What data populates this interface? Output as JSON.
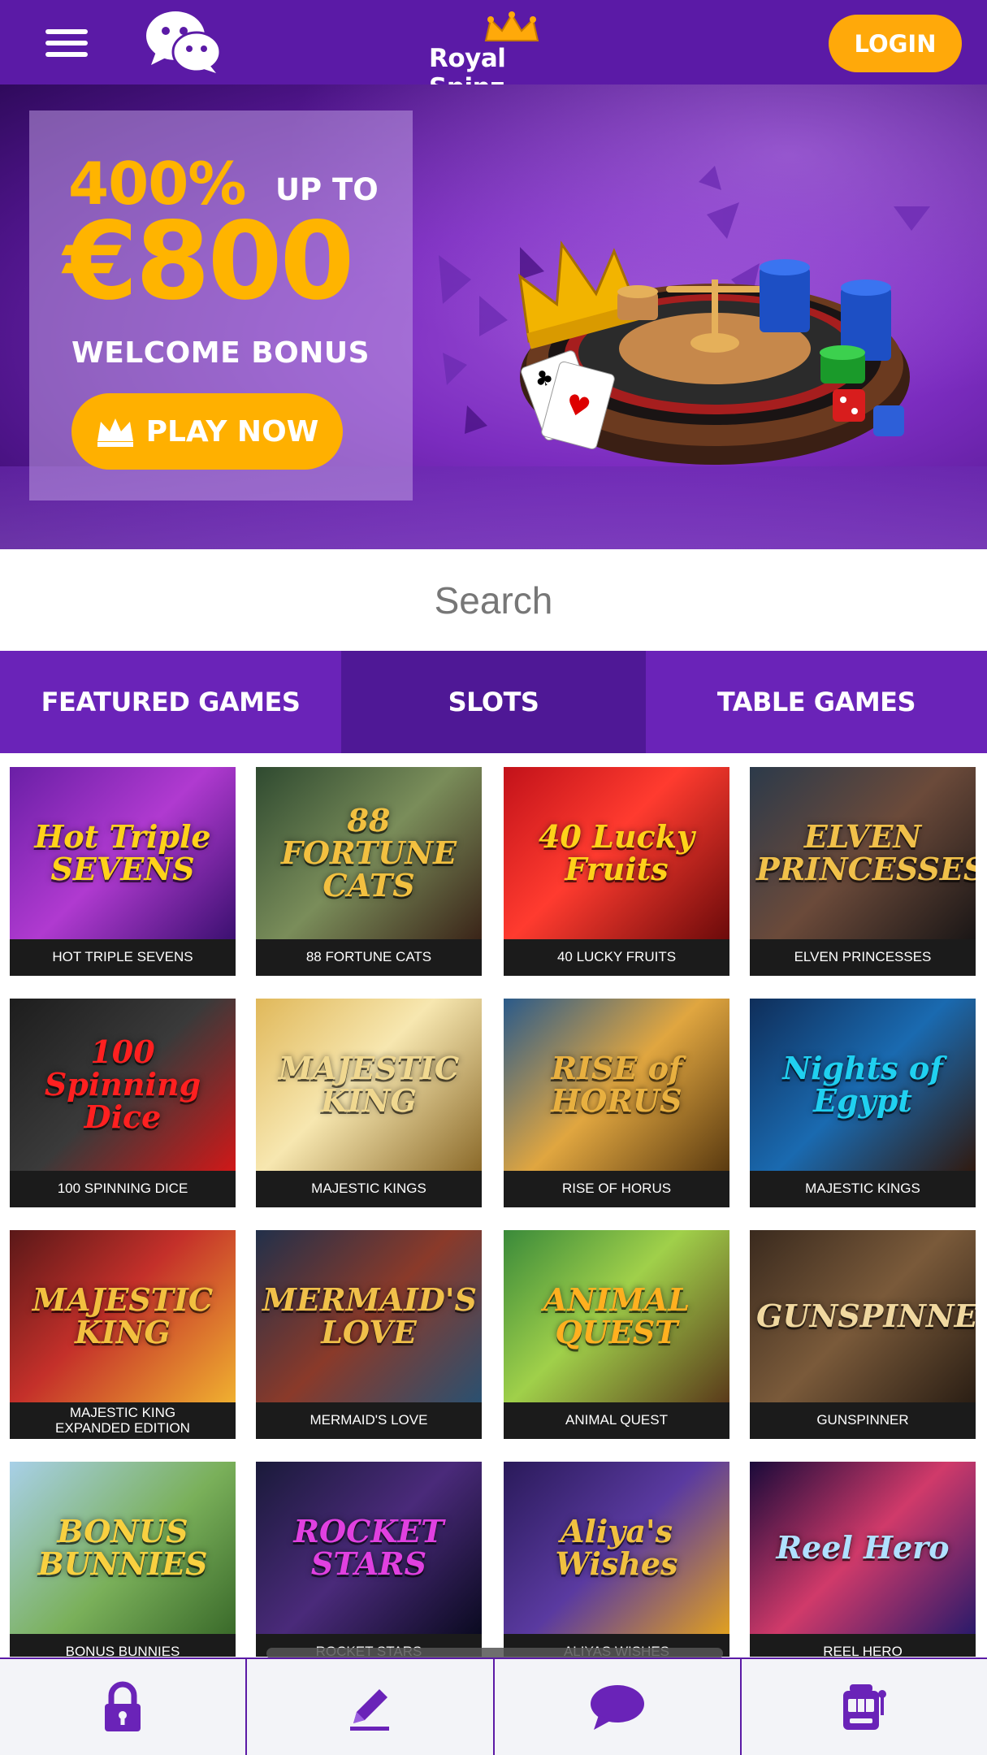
{
  "header": {
    "logo_text": "Royal Spinz",
    "login_label": "LOGIN"
  },
  "banner": {
    "percent": "400%",
    "up_to": "UP TO",
    "amount": "€800",
    "subtitle": "WELCOME BONUS",
    "cta_label": "PLAY NOW"
  },
  "search": {
    "placeholder": "Search"
  },
  "tabs": [
    {
      "label": "FEATURED GAMES"
    },
    {
      "label": "SLOTS",
      "active": true
    },
    {
      "label": "TABLE GAMES"
    }
  ],
  "games": [
    {
      "caption": "HOT TRIPLE SEVENS",
      "art": "Hot Triple SEVENS"
    },
    {
      "caption": "88 FORTUNE CATS",
      "art": "88 FORTUNE CATS"
    },
    {
      "caption": "40 LUCKY FRUITS",
      "art": "40 Lucky Fruits"
    },
    {
      "caption": "ELVEN PRINCESSES",
      "art": "ELVEN PRINCESSES"
    },
    {
      "caption": "100 SPINNING DICE",
      "art": "100 Spinning Dice"
    },
    {
      "caption": "MAJESTIC KINGS",
      "art": "MAJESTIC KING"
    },
    {
      "caption": "RISE OF HORUS",
      "art": "RISE of HORUS"
    },
    {
      "caption": "MAJESTIC KINGS",
      "art": "Nights of Egypt"
    },
    {
      "caption": "MAJESTIC KING\nEXPANDED EDITION",
      "art": "MAJESTIC KING"
    },
    {
      "caption": "MERMAID'S LOVE",
      "art": "MERMAID'S LOVE"
    },
    {
      "caption": "ANIMAL QUEST",
      "art": "ANIMAL QUEST"
    },
    {
      "caption": "GUNSPINNER",
      "art": "GUNSPINNER"
    },
    {
      "caption": "BONUS BUNNIES",
      "art": "BONUS BUNNIES"
    },
    {
      "caption": "ROCKET STARS",
      "art": "ROCKET STARS"
    },
    {
      "caption": "ALIYAS WISHES",
      "art": "Aliya's Wishes"
    },
    {
      "caption": "REEL HERO",
      "art": "Reel Hero"
    }
  ],
  "bottom_nav": [
    {
      "icon": "lock-icon"
    },
    {
      "icon": "pencil-icon"
    },
    {
      "icon": "chat-bubble-icon"
    },
    {
      "icon": "slot-machine-icon"
    }
  ],
  "colors": {
    "brand_purple": "#5b1aa6",
    "tab_active": "#4f1896",
    "accent_orange": "#ffa90a"
  }
}
